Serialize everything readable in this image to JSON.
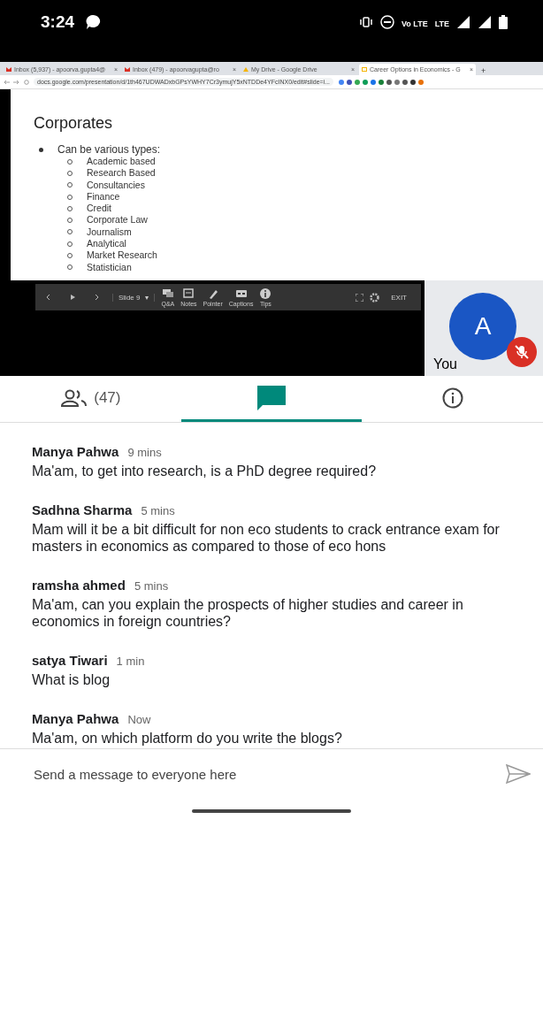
{
  "status_bar": {
    "time": "3:24",
    "network_labels": [
      "Vo LTE",
      "LTE"
    ]
  },
  "browser": {
    "tabs": [
      {
        "kind": "mail",
        "title": "Inbox (5,937) - apoorva.gupta4@",
        "close": "×",
        "selected": false
      },
      {
        "kind": "mail",
        "title": "Inbox (479) - apoorvagupta@ro",
        "close": "×",
        "selected": false
      },
      {
        "kind": "drive",
        "title": "My Drive - Google Drive",
        "close": "×",
        "selected": false
      },
      {
        "kind": "slides",
        "title": "Career Options in Economics - G",
        "close": "×",
        "selected": true
      }
    ],
    "new_tab": "+",
    "url": "docs.google.com/presentation/d/1th467UDWADxbGPsYWHY7Cr3ymujY5xNTDDe4YFcINX0/edit#slide=i..."
  },
  "slide": {
    "title": "Corporates",
    "bullet": "Can be various types:",
    "items": [
      "Academic based",
      "Research Based",
      "Consultancies",
      "Finance",
      "Credit",
      "Corporate Law",
      "Journalism",
      "Analytical",
      "Market Research",
      "Statistician"
    ]
  },
  "presenter_toolbar": {
    "slide_label": "Slide 9",
    "slide_menu": "▾",
    "tools": [
      {
        "kind": "qa",
        "label": "Q&A"
      },
      {
        "kind": "notes",
        "label": "Notes"
      },
      {
        "kind": "pointer",
        "label": "Pointer"
      },
      {
        "kind": "captions",
        "label": "Captions"
      },
      {
        "kind": "tips",
        "label": "Tips"
      }
    ],
    "exit": "EXIT"
  },
  "self_tile": {
    "initial": "A",
    "name": "You",
    "muted": true
  },
  "tabs": [
    {
      "kind": "people",
      "label": "(47)",
      "selected": false
    },
    {
      "kind": "chat",
      "selected": true
    },
    {
      "kind": "info",
      "selected": false
    }
  ],
  "messages": [
    {
      "sender": "Manya Pahwa",
      "time": "9 mins",
      "text": "Ma'am, to get into research, is a PhD degree required?"
    },
    {
      "sender": "Sadhna Sharma",
      "time": "5 mins",
      "text": "Mam will it be a bit difficult  for non eco students to crack entrance  exam for  masters in economics as compared  to those of eco hons"
    },
    {
      "sender": "ramsha ahmed",
      "time": "5 mins",
      "text": "Ma'am, can you explain the prospects of higher studies and career in economics in foreign countries?"
    },
    {
      "sender": "satya Tiwari",
      "time": "1 min",
      "text": "What is blog"
    },
    {
      "sender": "Manya Pahwa",
      "time": "Now",
      "text": "Ma'am, on which platform do you write the blogs?"
    }
  ],
  "composer": {
    "placeholder": "Send a message to everyone here"
  }
}
